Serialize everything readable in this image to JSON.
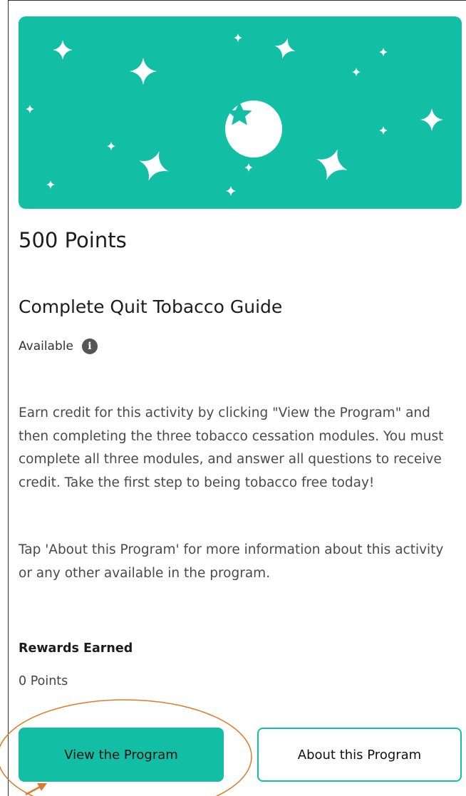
{
  "colors": {
    "accent": "#12bfa5",
    "annotation": "#e07a2a",
    "info_icon": "#555555"
  },
  "hero": {
    "icon": "star-icon"
  },
  "activity": {
    "points": "500 Points",
    "title": "Complete Quit Tobacco Guide",
    "status": "Available",
    "info_icon": "info-icon",
    "description_1": "Earn credit for this activity by clicking \"View the Program\" and then completing the three tobacco cessation modules. You must complete all three modules, and answer all questions to receive credit. Take the first step to being tobacco free today!",
    "description_2": "Tap 'About this Program' for more information about this activity or any other available in the program."
  },
  "rewards": {
    "label": "Rewards Earned",
    "value": "0 Points"
  },
  "actions": {
    "view_label": "View the Program",
    "about_label": "About this Program"
  }
}
